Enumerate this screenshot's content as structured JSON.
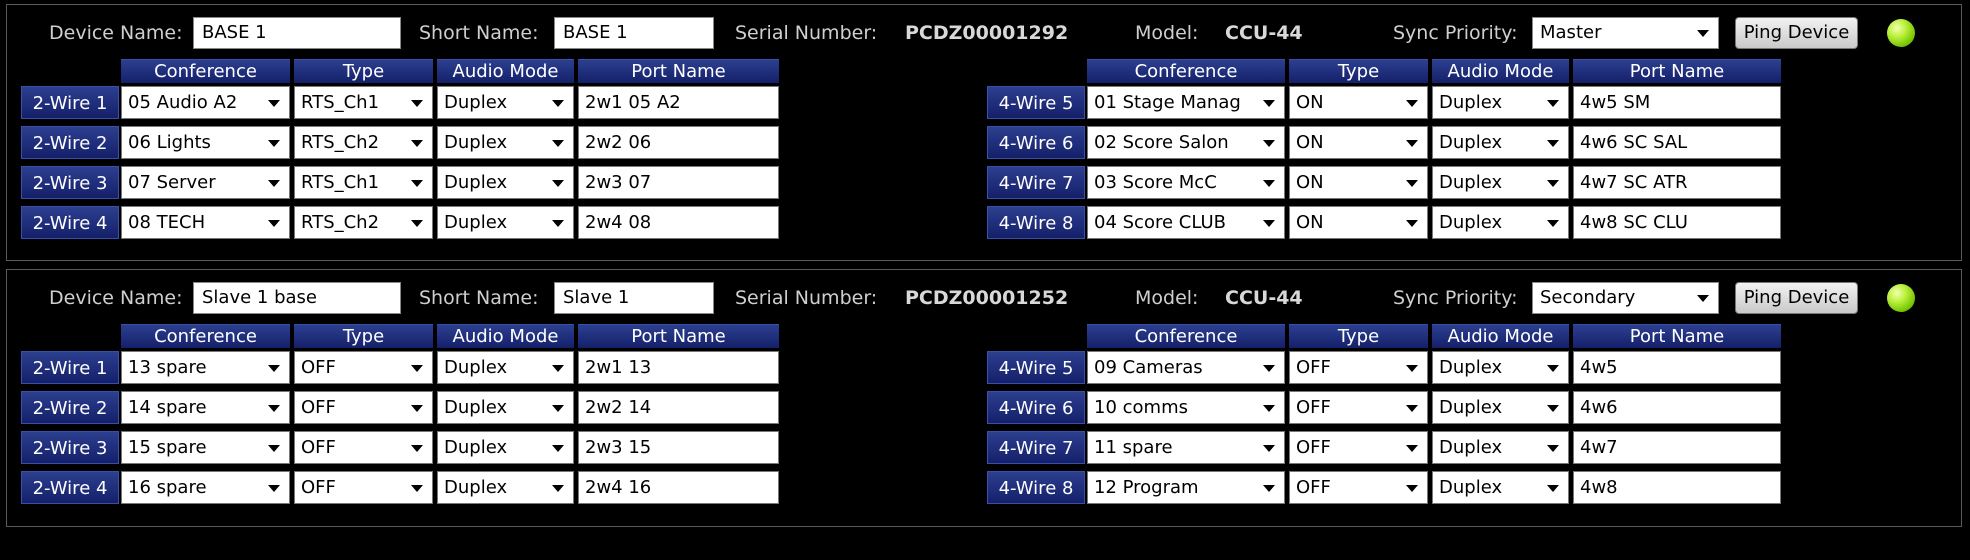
{
  "labels": {
    "device_name": "Device Name:",
    "short_name": "Short Name:",
    "serial_number": "Serial Number:",
    "model": "Model:",
    "sync_priority": "Sync Priority:",
    "ping_device": "Ping Device",
    "col_conference": "Conference",
    "col_type": "Type",
    "col_audio_mode": "Audio Mode",
    "col_port_name": "Port Name"
  },
  "colors": {
    "background": "#000000",
    "header_blue": "#1f2e7e",
    "status_led": "#7fd400"
  },
  "devices": [
    {
      "device_name": "BASE 1",
      "short_name": "BASE 1",
      "serial_number": "PCDZ00001292",
      "model": "CCU-44",
      "sync_priority": "Master",
      "two_wire": [
        {
          "label": "2-Wire 1",
          "conference": "05 Audio A2",
          "type": "RTS_Ch1",
          "audio_mode": "Duplex",
          "port_name": "2w1 05 A2"
        },
        {
          "label": "2-Wire 2",
          "conference": "06 Lights",
          "type": "RTS_Ch2",
          "audio_mode": "Duplex",
          "port_name": "2w2 06"
        },
        {
          "label": "2-Wire 3",
          "conference": "07 Server",
          "type": "RTS_Ch1",
          "audio_mode": "Duplex",
          "port_name": "2w3 07"
        },
        {
          "label": "2-Wire 4",
          "conference": "08  TECH",
          "type": "RTS_Ch2",
          "audio_mode": "Duplex",
          "port_name": "2w4 08"
        }
      ],
      "four_wire": [
        {
          "label": "4-Wire 5",
          "conference": "01 Stage Manag",
          "type": "ON",
          "audio_mode": "Duplex",
          "port_name": "4w5 SM"
        },
        {
          "label": "4-Wire 6",
          "conference": "02 Score Salon",
          "type": "ON",
          "audio_mode": "Duplex",
          "port_name": "4w6 SC SAL"
        },
        {
          "label": "4-Wire 7",
          "conference": "03 Score McC",
          "type": "ON",
          "audio_mode": "Duplex",
          "port_name": "4w7 SC ATR"
        },
        {
          "label": "4-Wire 8",
          "conference": "04 Score CLUB",
          "type": "ON",
          "audio_mode": "Duplex",
          "port_name": "4w8 SC CLU"
        }
      ]
    },
    {
      "device_name": "Slave 1 base",
      "short_name": "Slave 1",
      "serial_number": "PCDZ00001252",
      "model": "CCU-44",
      "sync_priority": "Secondary",
      "two_wire": [
        {
          "label": "2-Wire 1",
          "conference": "13 spare",
          "type": "OFF",
          "audio_mode": "Duplex",
          "port_name": "2w1 13"
        },
        {
          "label": "2-Wire 2",
          "conference": "14 spare",
          "type": "OFF",
          "audio_mode": "Duplex",
          "port_name": "2w2 14"
        },
        {
          "label": "2-Wire 3",
          "conference": "15 spare",
          "type": "OFF",
          "audio_mode": "Duplex",
          "port_name": "2w3 15"
        },
        {
          "label": "2-Wire 4",
          "conference": "16 spare",
          "type": "OFF",
          "audio_mode": "Duplex",
          "port_name": "2w4 16"
        }
      ],
      "four_wire": [
        {
          "label": "4-Wire 5",
          "conference": "09 Cameras",
          "type": "OFF",
          "audio_mode": "Duplex",
          "port_name": "4w5"
        },
        {
          "label": "4-Wire 6",
          "conference": "10 comms",
          "type": "OFF",
          "audio_mode": "Duplex",
          "port_name": "4w6"
        },
        {
          "label": "4-Wire 7",
          "conference": "11 spare",
          "type": "OFF",
          "audio_mode": "Duplex",
          "port_name": "4w7"
        },
        {
          "label": "4-Wire 8",
          "conference": "12 Program",
          "type": "OFF",
          "audio_mode": "Duplex",
          "port_name": "4w8"
        }
      ]
    }
  ]
}
